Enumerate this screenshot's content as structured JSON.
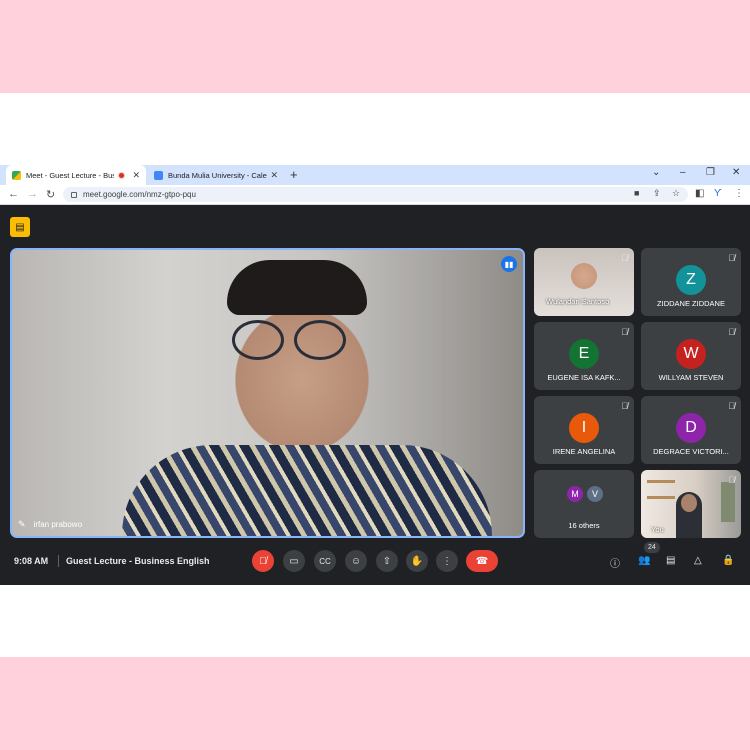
{
  "browser": {
    "tabs": [
      {
        "label": "Meet - Guest Lecture - Busin",
        "recording": true,
        "active": true
      },
      {
        "label": "Bunda Mulia University - Calend",
        "active": false
      }
    ],
    "new_tab": "+",
    "url": "meet.google.com/nmz-gtpo-pqu"
  },
  "meeting": {
    "main_speaker": "irfan prabowo",
    "participants": [
      {
        "name": "Wulandari Santoso",
        "type": "video",
        "muted": true
      },
      {
        "name": "ZIDDANE ZIDDANE",
        "initial": "Z",
        "color": "#12939a",
        "muted": true
      },
      {
        "name": "EUGENE ISA KAFK...",
        "initial": "E",
        "color": "#137333",
        "muted": true
      },
      {
        "name": "WILLYAM STEVEN",
        "initial": "W",
        "color": "#c5221f",
        "muted": true
      },
      {
        "name": "IRENE ANGELINA",
        "initial": "I",
        "color": "#e8590c",
        "muted": true
      },
      {
        "name": "DEGRACE VICTORI...",
        "initial": "D",
        "color": "#8e24aa",
        "muted": true
      }
    ],
    "others": {
      "label": "16 others",
      "initials": [
        "M",
        "V"
      ],
      "colors": [
        "#8e24aa",
        "#5f6f86"
      ]
    },
    "self": {
      "name": "You",
      "muted": true
    }
  },
  "bottom_bar": {
    "time": "9:08 AM",
    "title": "Guest Lecture - Business English",
    "participant_count": "24"
  }
}
